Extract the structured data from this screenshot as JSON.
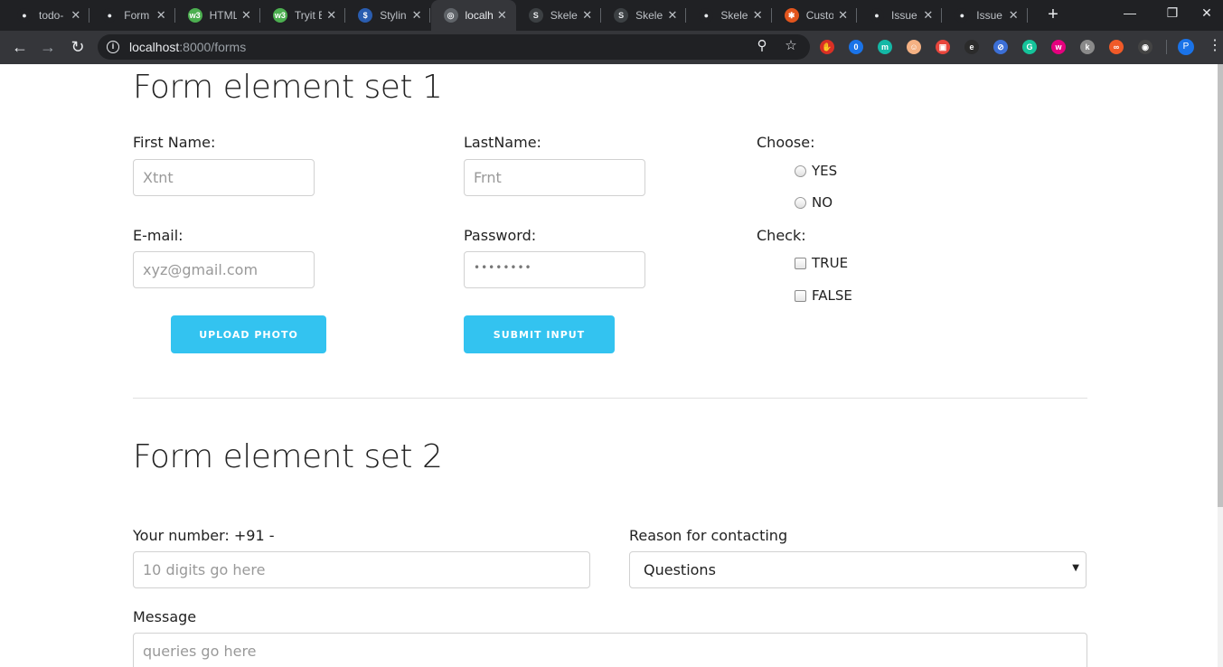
{
  "browser": {
    "tabs": [
      {
        "label": "todo-",
        "favicon": "github-icon",
        "fav_bg": "#202124",
        "fav_fg": "#e8eaed",
        "fav_char": "●"
      },
      {
        "label": "Form",
        "favicon": "github-icon",
        "fav_bg": "#202124",
        "fav_fg": "#e8eaed",
        "fav_char": "●"
      },
      {
        "label": "HTML",
        "favicon": "w3schools-icon",
        "fav_bg": "#4caf50",
        "fav_fg": "#ffffff",
        "fav_char": "w3"
      },
      {
        "label": "Tryit E",
        "favicon": "w3schools-icon",
        "fav_bg": "#4caf50",
        "fav_fg": "#ffffff",
        "fav_char": "w3"
      },
      {
        "label": "Stylin",
        "favicon": "styling-site-icon",
        "fav_bg": "#2a5db0",
        "fav_fg": "#ffffff",
        "fav_char": "$"
      },
      {
        "label": "localh",
        "favicon": "globe-icon",
        "fav_bg": "#5f6368",
        "fav_fg": "#e8eaed",
        "fav_char": "◎",
        "active": true
      },
      {
        "label": "Skele",
        "favicon": "skeleton-icon",
        "fav_bg": "#3c4043",
        "fav_fg": "#e8eaed",
        "fav_char": "S"
      },
      {
        "label": "Skele",
        "favicon": "skeleton-icon",
        "fav_bg": "#3c4043",
        "fav_fg": "#e8eaed",
        "fav_char": "S"
      },
      {
        "label": "Skele",
        "favicon": "github-icon",
        "fav_bg": "#202124",
        "fav_fg": "#e8eaed",
        "fav_char": "●"
      },
      {
        "label": "Custo",
        "favicon": "custom-site-icon",
        "fav_bg": "#e2551d",
        "fav_fg": "#ffffff",
        "fav_char": "✱"
      },
      {
        "label": "Issue",
        "favicon": "github-icon",
        "fav_bg": "#202124",
        "fav_fg": "#e8eaed",
        "fav_char": "●"
      },
      {
        "label": "Issue",
        "favicon": "github-icon",
        "fav_bg": "#202124",
        "fav_fg": "#e8eaed",
        "fav_char": "●"
      }
    ],
    "url_host": "localhost",
    "url_path": ":8000/forms",
    "extensions": [
      {
        "name": "adblock-icon",
        "bg": "#d93025",
        "char": "✋"
      },
      {
        "name": "extension-badge-icon",
        "bg": "#1a73e8",
        "char": "0"
      },
      {
        "name": "m-extension-icon",
        "bg": "#14b8a6",
        "char": "m"
      },
      {
        "name": "face-extension-icon",
        "bg": "#f4b183",
        "char": "☺"
      },
      {
        "name": "screen-capture-icon",
        "bg": "#e8453c",
        "char": "▣"
      },
      {
        "name": "edge-like-icon",
        "bg": "#2b2b2b",
        "char": "e"
      },
      {
        "name": "block-icon",
        "bg": "#3c6fd6",
        "char": "⊘"
      },
      {
        "name": "grammarly-icon",
        "bg": "#15c39a",
        "char": "G"
      },
      {
        "name": "w-extension-icon",
        "bg": "#e6007e",
        "char": "w"
      },
      {
        "name": "k-extension-icon",
        "bg": "#8a8a8a",
        "char": "k"
      },
      {
        "name": "infinity-icon",
        "bg": "#f05a28",
        "char": "∞"
      },
      {
        "name": "glasses-icon",
        "bg": "#444444",
        "char": "◉"
      }
    ],
    "profile_initial": "P"
  },
  "set1": {
    "title": "Form element set 1",
    "first_name_label": "First Name:",
    "first_name_placeholder": "Xtnt",
    "last_name_label": "LastName:",
    "last_name_placeholder": "Frnt",
    "choose_label": "Choose:",
    "radio_yes": "YES",
    "radio_no": "NO",
    "email_label": "E-mail:",
    "email_placeholder": "xyz@gmail.com",
    "password_label": "Password:",
    "password_value": "••••••••",
    "check_label": "Check:",
    "check_true": "TRUE",
    "check_false": "FALSE",
    "upload_button": "UPLOAD PHOTO",
    "submit_button": "SUBMIT INPUT"
  },
  "set2": {
    "title": "Form element set 2",
    "number_label": "Your number: +91 -",
    "number_placeholder": "10 digits go here",
    "reason_label": "Reason for contacting",
    "reason_selected": "Questions",
    "message_label": "Message",
    "message_placeholder": "queries go here"
  },
  "colors": {
    "button": "#33c3f0",
    "tabstrip": "#202124",
    "toolbar": "#35363a"
  }
}
